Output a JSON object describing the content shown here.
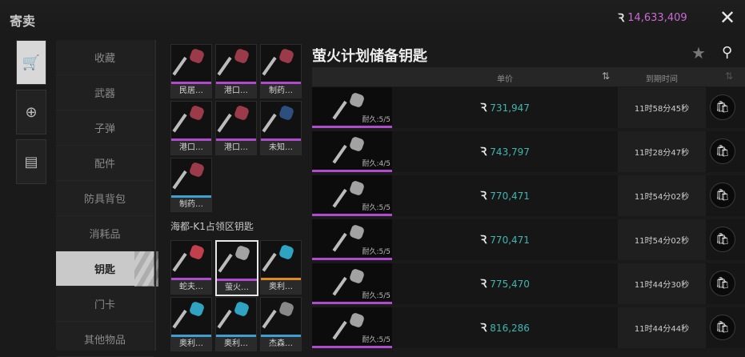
{
  "header": {
    "title": "寄卖",
    "currency_value": "14,633,409"
  },
  "categories": [
    "收藏",
    "武器",
    "子弹",
    "配件",
    "防具背包",
    "消耗品",
    "钥匙",
    "门卡",
    "其他物品"
  ],
  "active_category": "钥匙",
  "key_tiles_group1": [
    {
      "label": "民居…",
      "bar": "#b04bd0",
      "head": "#9b3a48"
    },
    {
      "label": "港口…",
      "bar": "#b04bd0",
      "head": "#9b3a48"
    },
    {
      "label": "制药…",
      "bar": "#b04bd0",
      "head": "#9b3a48"
    },
    {
      "label": "港口…",
      "bar": "#b04bd0",
      "head": "#9b3a48"
    },
    {
      "label": "港口…",
      "bar": "#b04bd0",
      "head": "#9b3a48"
    },
    {
      "label": "未知…",
      "bar": "#b04bd0",
      "head": "#2d4f7f"
    },
    {
      "label": "制药…",
      "bar": "#3da0d0",
      "head": "#9b3a48"
    }
  ],
  "group2_header": "海都-K1占领区钥匙",
  "key_tiles_group2": [
    {
      "label": "蛇夫…",
      "bar": "#b04bd0",
      "head": "#c43f4c"
    },
    {
      "label": "萤火…",
      "bar": "#b04bd0",
      "head": "#a2a2a2"
    },
    {
      "label": "奥利…",
      "bar": "#e08a1e",
      "head": "#2fa3c2"
    },
    {
      "label": "奥利…",
      "bar": "#3da0d0",
      "head": "#2fa3c2"
    },
    {
      "label": "奥利…",
      "bar": "#3da0d0",
      "head": "#2fa3c2"
    },
    {
      "label": "杰森…",
      "bar": "#3da0d0",
      "head": "#888888"
    }
  ],
  "item": {
    "name": "萤火计划储备钥匙"
  },
  "table": {
    "col_price": "单价",
    "col_expire": "到期时间"
  },
  "listings": [
    {
      "durability": "耐久:5/5",
      "price": "731,947",
      "expire": "11时58分45秒"
    },
    {
      "durability": "耐久:4/5",
      "price": "743,797",
      "expire": "11时28分47秒"
    },
    {
      "durability": "耐久:5/5",
      "price": "770,471",
      "expire": "11时54分02秒"
    },
    {
      "durability": "耐久:5/5",
      "price": "770,471",
      "expire": "11时54分02秒"
    },
    {
      "durability": "耐久:5/5",
      "price": "775,470",
      "expire": "11时44分30秒"
    },
    {
      "durability": "耐久:5/5",
      "price": "816,286",
      "expire": "11时44分44秒"
    }
  ],
  "colors": {
    "accent_purple": "#b04bd0",
    "price_teal": "#3fb6b0",
    "currency_pink": "#c86bd0"
  }
}
